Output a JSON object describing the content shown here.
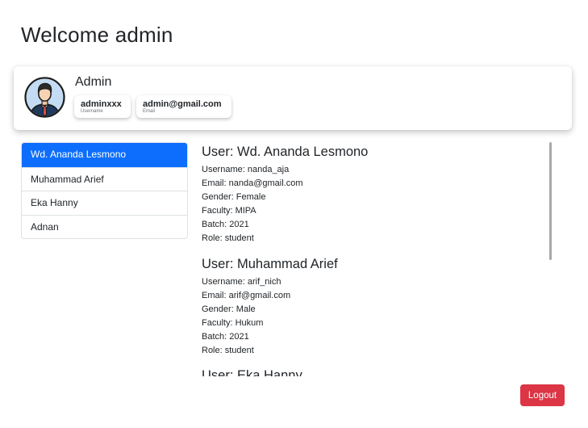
{
  "page": {
    "title": "Welcome admin"
  },
  "profile": {
    "name": "Admin",
    "username": "adminxxx",
    "username_label": "Username",
    "email": "admin@gmail.com",
    "email_label": "Email",
    "avatar_icon": "user-avatar-icon"
  },
  "sidebar": {
    "items": [
      {
        "label": "Wd. Ananda Lesmono",
        "active": true
      },
      {
        "label": "Muhammad Arief",
        "active": false
      },
      {
        "label": "Eka Hanny",
        "active": false
      },
      {
        "label": "Adnan",
        "active": false
      }
    ]
  },
  "users": [
    {
      "heading": "User: Wd. Ananda Lesmono",
      "username": "Username: nanda_aja",
      "email": "Email: nanda@gmail.com",
      "gender": "Gender: Female",
      "faculty": "Faculty: MIPA",
      "batch": "Batch: 2021",
      "role": "Role: student"
    },
    {
      "heading": "User: Muhammad Arief",
      "username": "Username: arif_nich",
      "email": "Email: arif@gmail.com",
      "gender": "Gender: Male",
      "faculty": "Faculty: Hukum",
      "batch": "Batch: 2021",
      "role": "Role: student"
    },
    {
      "heading": "User: Eka Hanny"
    }
  ],
  "actions": {
    "logout_label": "Logout"
  },
  "colors": {
    "primary": "#0d6efd",
    "danger": "#dc3545",
    "text": "#212529"
  }
}
